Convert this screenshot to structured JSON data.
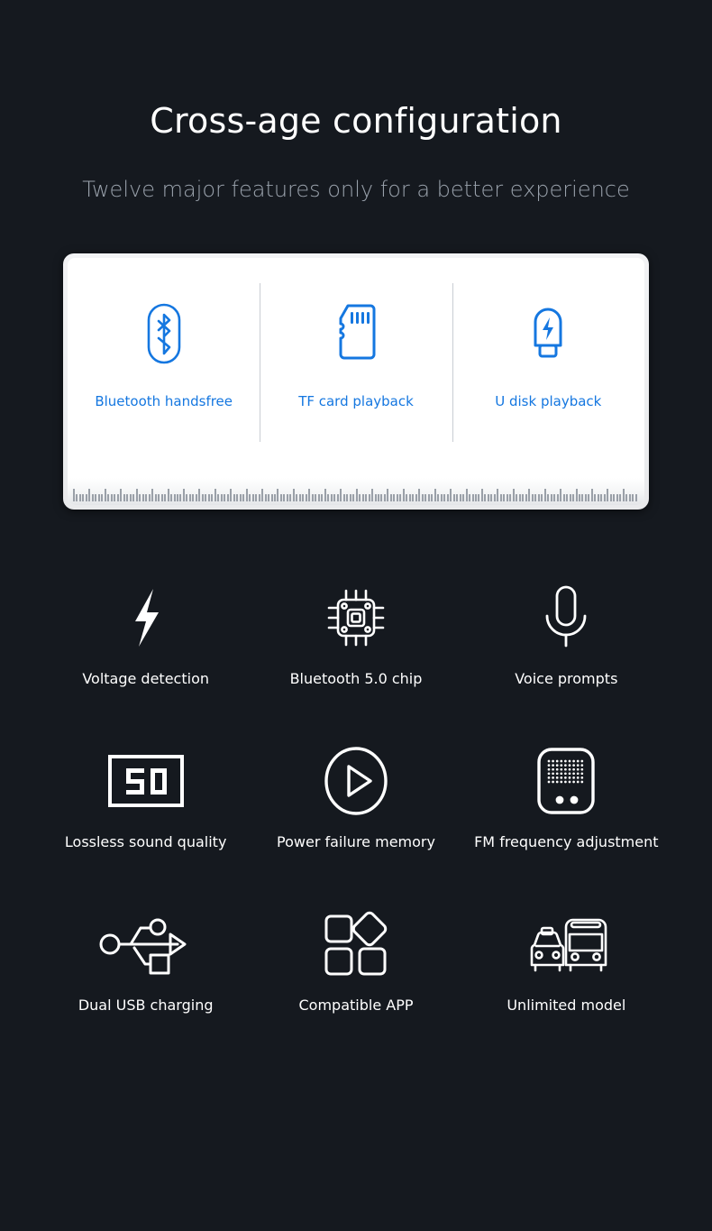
{
  "header": {
    "title": "Cross-age configuration",
    "subtitle": "Twelve major features only for a better experience"
  },
  "colors": {
    "background": "#15191f",
    "accent_blue": "#1577e0",
    "card_background": "#ffffff",
    "label_white": "#ffffff",
    "subtitle_gray": "#9aa2ac"
  },
  "card": {
    "items": [
      {
        "label": "Bluetooth handsfree",
        "icon": "bluetooth-icon"
      },
      {
        "label": "TF card playback",
        "icon": "tf-card-icon"
      },
      {
        "label": "U disk playback",
        "icon": "usb-disk-icon"
      }
    ],
    "ruler": {
      "tick_groups": 36,
      "ticks_per_group": 5
    }
  },
  "features": [
    {
      "label": "Voltage detection",
      "icon": "lightning-bolt-icon"
    },
    {
      "label": "Bluetooth 5.0 chip",
      "icon": "cpu-chip-icon"
    },
    {
      "label": "Voice prompts",
      "icon": "microphone-icon"
    },
    {
      "label": "Lossless sound quality",
      "icon": "sq-badge-icon"
    },
    {
      "label": "Power failure memory",
      "icon": "play-circle-icon"
    },
    {
      "label": "FM frequency adjustment",
      "icon": "radio-icon"
    },
    {
      "label": "Dual USB charging",
      "icon": "usb-trident-icon"
    },
    {
      "label": "Compatible APP",
      "icon": "app-grid-icon"
    },
    {
      "label": "Unlimited model",
      "icon": "taxi-bus-icon"
    }
  ]
}
